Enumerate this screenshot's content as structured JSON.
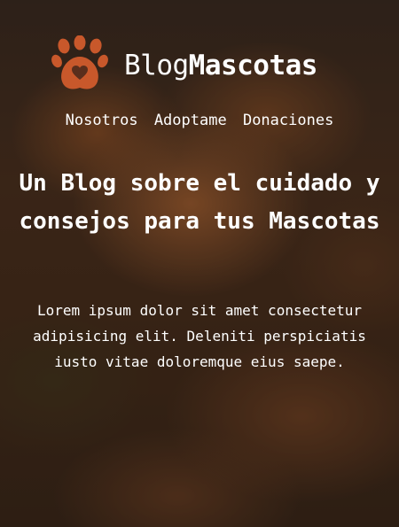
{
  "brand": {
    "name_part1": "Blog",
    "name_part2": "Mascotas",
    "logo_icon": "paw-heart-icon",
    "logo_color": "#c8582b"
  },
  "nav": {
    "items": [
      {
        "label": "Nosotros"
      },
      {
        "label": "Adoptame"
      },
      {
        "label": "Donaciones"
      }
    ]
  },
  "hero": {
    "title": "Un Blog sobre el cuidado y consejos para tus Mascotas",
    "description": "Lorem ipsum dolor sit amet consectetur adipisicing elit. Deleniti perspiciatis iusto vitae doloremque eius saepe."
  },
  "colors": {
    "text": "#ffffff",
    "accent": "#c8582b"
  }
}
